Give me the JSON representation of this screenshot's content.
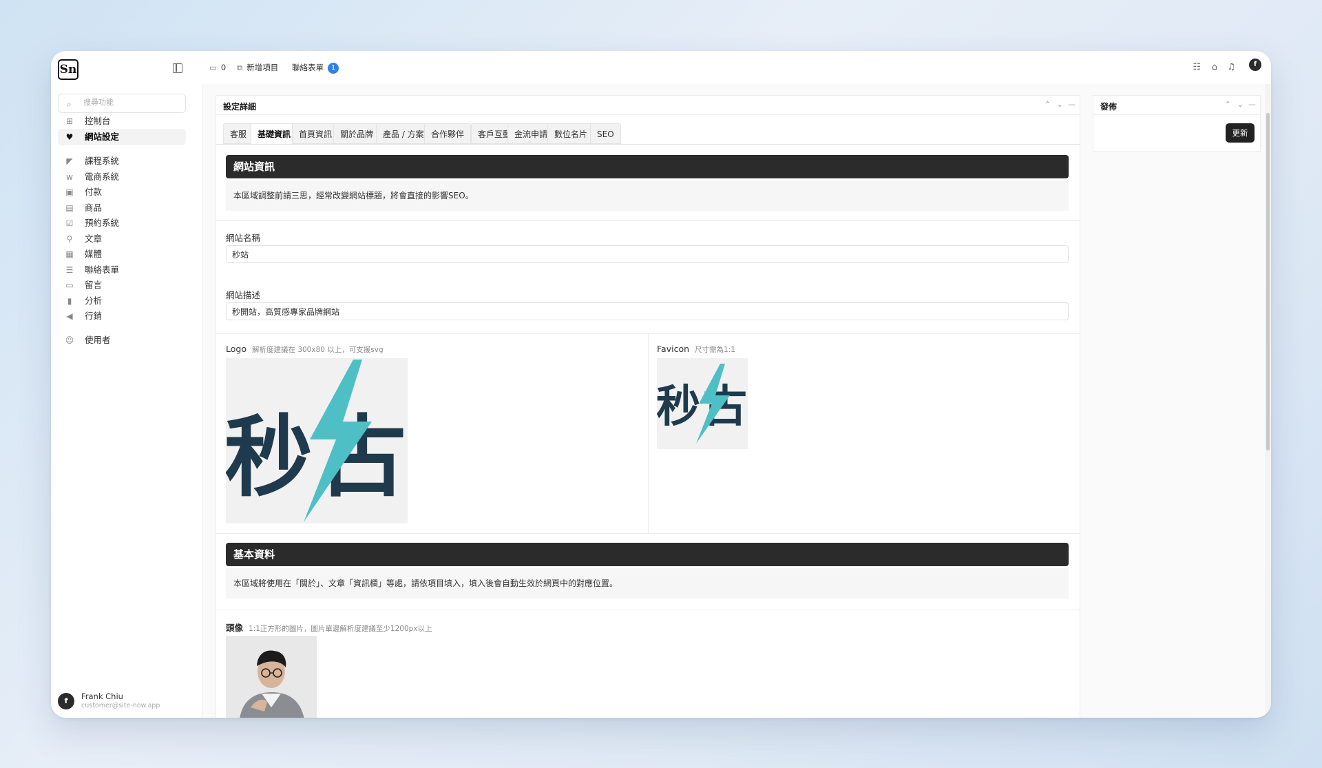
{
  "brand": {
    "logo_text": "Sn"
  },
  "sidebar": {
    "search_placeholder": "搜尋功能",
    "items": [
      {
        "label": "控制台",
        "icon": "dashboard-icon",
        "glyph": "⊞"
      },
      {
        "label": "網站設定",
        "icon": "heart-icon",
        "glyph": "♥",
        "active": true
      },
      {
        "label": "課程系統",
        "icon": "course-icon",
        "glyph": "◤"
      },
      {
        "label": "電商系統",
        "icon": "woo-icon",
        "glyph": "w"
      },
      {
        "label": "付款",
        "icon": "payment-icon",
        "glyph": "▣"
      },
      {
        "label": "商品",
        "icon": "archive-icon",
        "glyph": "▤"
      },
      {
        "label": "預約系統",
        "icon": "booking-icon",
        "glyph": "☑"
      },
      {
        "label": "文章",
        "icon": "pin-icon",
        "glyph": "⚲"
      },
      {
        "label": "媒體",
        "icon": "media-icon",
        "glyph": "▦"
      },
      {
        "label": "聯絡表單",
        "icon": "form-icon",
        "glyph": "☰"
      },
      {
        "label": "留言",
        "icon": "comment-icon",
        "glyph": "▭"
      },
      {
        "label": "分析",
        "icon": "chart-icon",
        "glyph": "▮"
      },
      {
        "label": "行銷",
        "icon": "megaphone-icon",
        "glyph": "◀"
      },
      {
        "label": "使用者",
        "icon": "users-icon",
        "glyph": "☺"
      }
    ],
    "user": {
      "name": "Frank Chiu",
      "email": "customer@site-now.app",
      "avatar_letter": "f"
    }
  },
  "topbar": {
    "comments_count": "0",
    "new_item": "新增項目",
    "contact_form": "聯絡表單",
    "contact_badge": "1",
    "avatar_letter": "f"
  },
  "panel": {
    "title": "設定詳細",
    "tabs": [
      "客服",
      "基礎資訊",
      "首頁資訊",
      "關於品牌",
      "產品 / 方案",
      "合作夥伴",
      "客戶互動",
      "金流申請",
      "數位名片",
      "SEO"
    ],
    "active_tab": "基礎資訊",
    "section1": {
      "title": "網站資訊",
      "note": "本區域調整前請三思，經常改變網站標題，將會直接的影響SEO。",
      "site_name_label": "網站名稱",
      "site_name_value": "秒站",
      "site_desc_label": "網站描述",
      "site_desc_value": "秒開站，高質感專家品牌網站",
      "logo_label": "Logo",
      "logo_hint": "解析度建議在 300x80 以上，可支援svg",
      "logo_text": "秒站",
      "favicon_label": "Favicon",
      "favicon_hint": "尺寸需為1:1"
    },
    "section2": {
      "title": "基本資料",
      "note": "本區域將使用在「關於」、文章「資訊欄」等處，請依項目填入，填入後會自動生效於網頁中的對應位置。",
      "avatar_label": "頭像",
      "avatar_hint": "1:1正方形的圖片，圖片單邊解析度建議至少1200px以上"
    }
  },
  "publish": {
    "title": "發佈",
    "update_label": "更新"
  },
  "colors": {
    "accent_dark": "#2b2b2b",
    "badge_blue": "#2f80ed",
    "logo_navy": "#1f3a4d",
    "logo_teal": "#4fbfc6"
  }
}
